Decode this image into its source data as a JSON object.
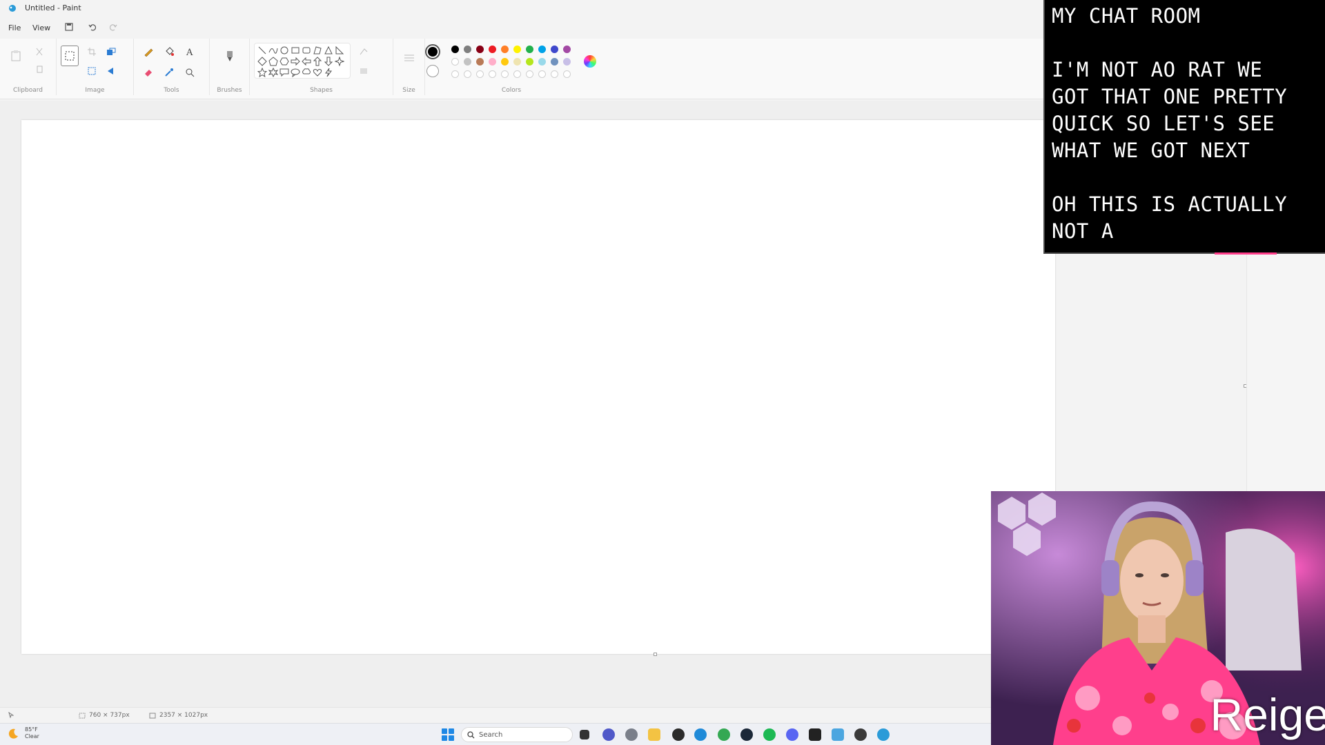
{
  "window": {
    "title": "Untitled - Paint"
  },
  "menu": {
    "file_label": "File",
    "view_label": "View"
  },
  "ribbon": {
    "groups": {
      "clipboard": "Clipboard",
      "image": "Image",
      "tools": "Tools",
      "brushes": "Brushes",
      "shapes": "Shapes",
      "size": "Size",
      "colors": "Colors"
    },
    "primary_color": "#000000",
    "secondary_color": "#ffffff",
    "palette_row1": [
      "#000000",
      "#7f7f7f",
      "#880015",
      "#ed1c24",
      "#ff7f27",
      "#fff200",
      "#22b14c",
      "#00a2e8",
      "#3f48cc",
      "#a349a4"
    ],
    "palette_row2": [
      "#ffffff",
      "#c3c3c3",
      "#b97a57",
      "#ffaec9",
      "#ffc90e",
      "#efe4b0",
      "#b5e61d",
      "#99d9ea",
      "#7092be",
      "#c8bfe7"
    ]
  },
  "status": {
    "selection_size": "760 × 737px",
    "canvas_size": "2357 × 1027px"
  },
  "taskbar": {
    "weather_temp": "85°F",
    "weather_desc": "Clear",
    "search_placeholder": "Search"
  },
  "chat_overlay": {
    "lines": [
      "MY CHAT ROOM",
      "",
      "I'M NOT AO RAT WE",
      "GOT THAT ONE PRETTY",
      "QUICK SO LET'S SEE",
      "WHAT WE GOT NEXT",
      "",
      "OH THIS IS ACTUALLY",
      "NOT A"
    ]
  },
  "webcam": {
    "streamer_name": "Reige"
  }
}
